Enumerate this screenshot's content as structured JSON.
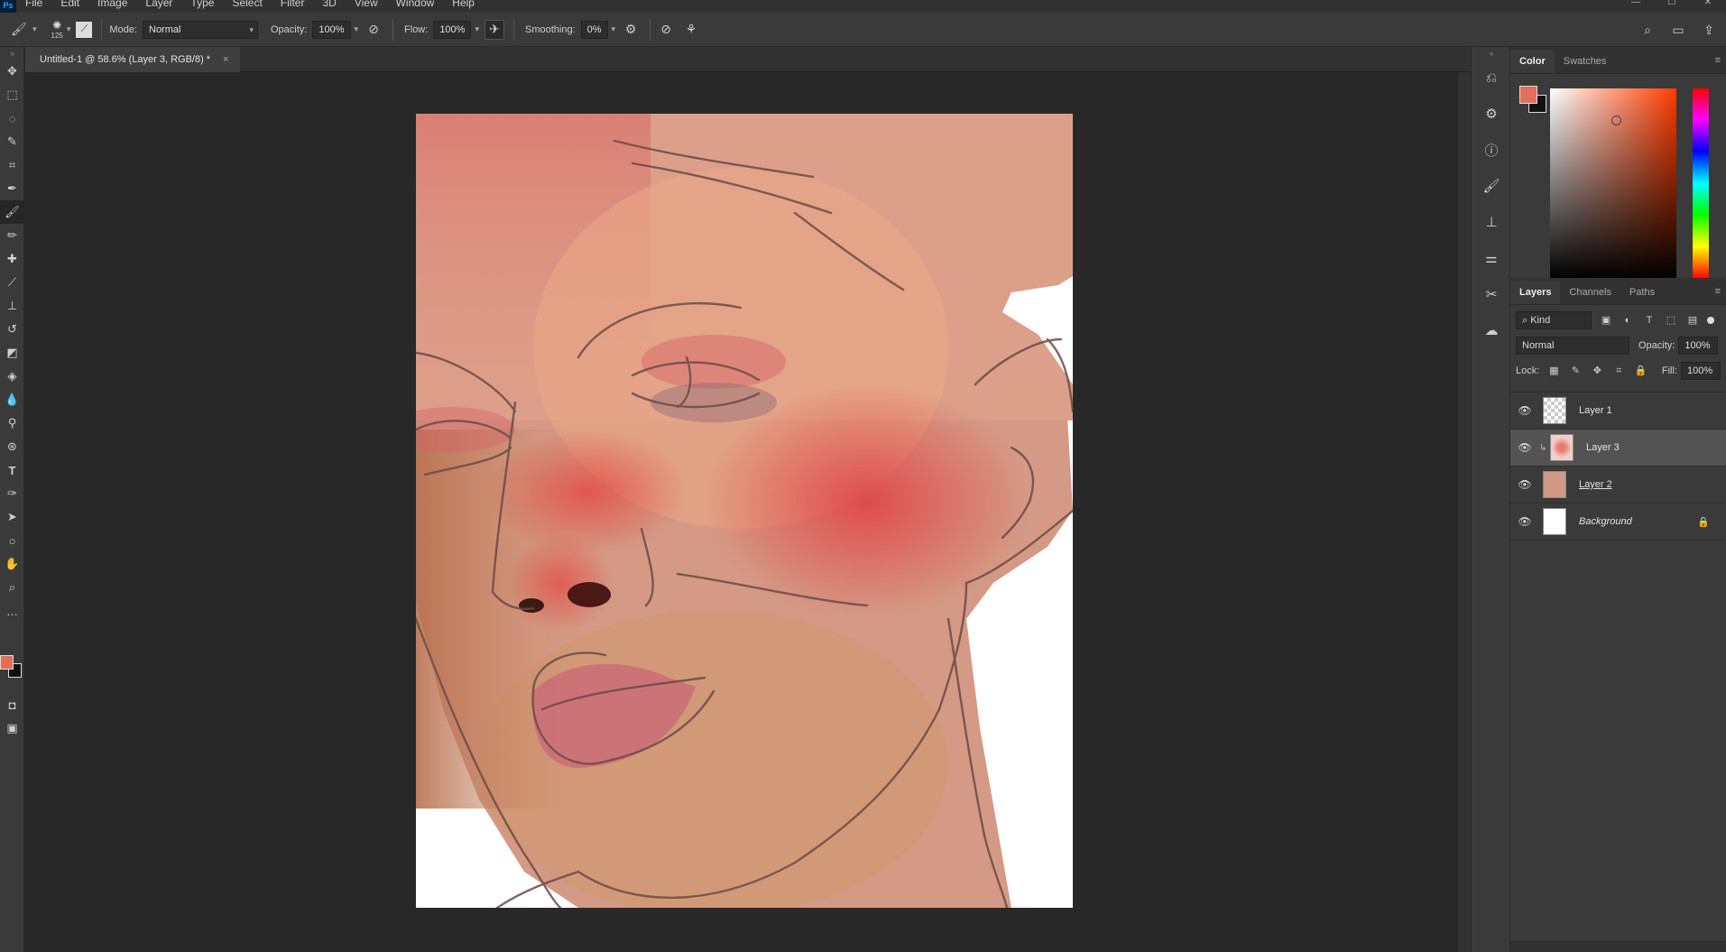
{
  "menu": [
    "File",
    "Edit",
    "Image",
    "Layer",
    "Type",
    "Select",
    "Filter",
    "3D",
    "View",
    "Window",
    "Help"
  ],
  "logo": "Ps",
  "window_buttons": [
    "—",
    "☐",
    "✕"
  ],
  "options": {
    "brush_size": "125",
    "mode_label": "Mode:",
    "mode_value": "Normal",
    "opacity_label": "Opacity:",
    "opacity_value": "100%",
    "flow_label": "Flow:",
    "flow_value": "100%",
    "smoothing_label": "Smoothing:",
    "smoothing_value": "0%"
  },
  "document": {
    "tab_title": "Untitled-1 @ 58.6% (Layer 3, RGB/8) *",
    "close": "×"
  },
  "colors": {
    "foreground": "#e0705c",
    "background": "#111111"
  },
  "color_panel": {
    "tabs": [
      "Color",
      "Swatches"
    ],
    "active_tab": "Color"
  },
  "layers_panel": {
    "tabs": [
      "Layers",
      "Channels",
      "Paths"
    ],
    "filter_value": "Kind",
    "blend_mode": "Normal",
    "opacity_label": "Opacity:",
    "opacity_value": "100%",
    "lock_label": "Lock:",
    "fill_label": "Fill:",
    "fill_value": "100%",
    "layers": [
      {
        "name": "Layer 1"
      },
      {
        "name": "Layer 3"
      },
      {
        "name": "Layer 2"
      },
      {
        "name": "Background"
      }
    ]
  }
}
